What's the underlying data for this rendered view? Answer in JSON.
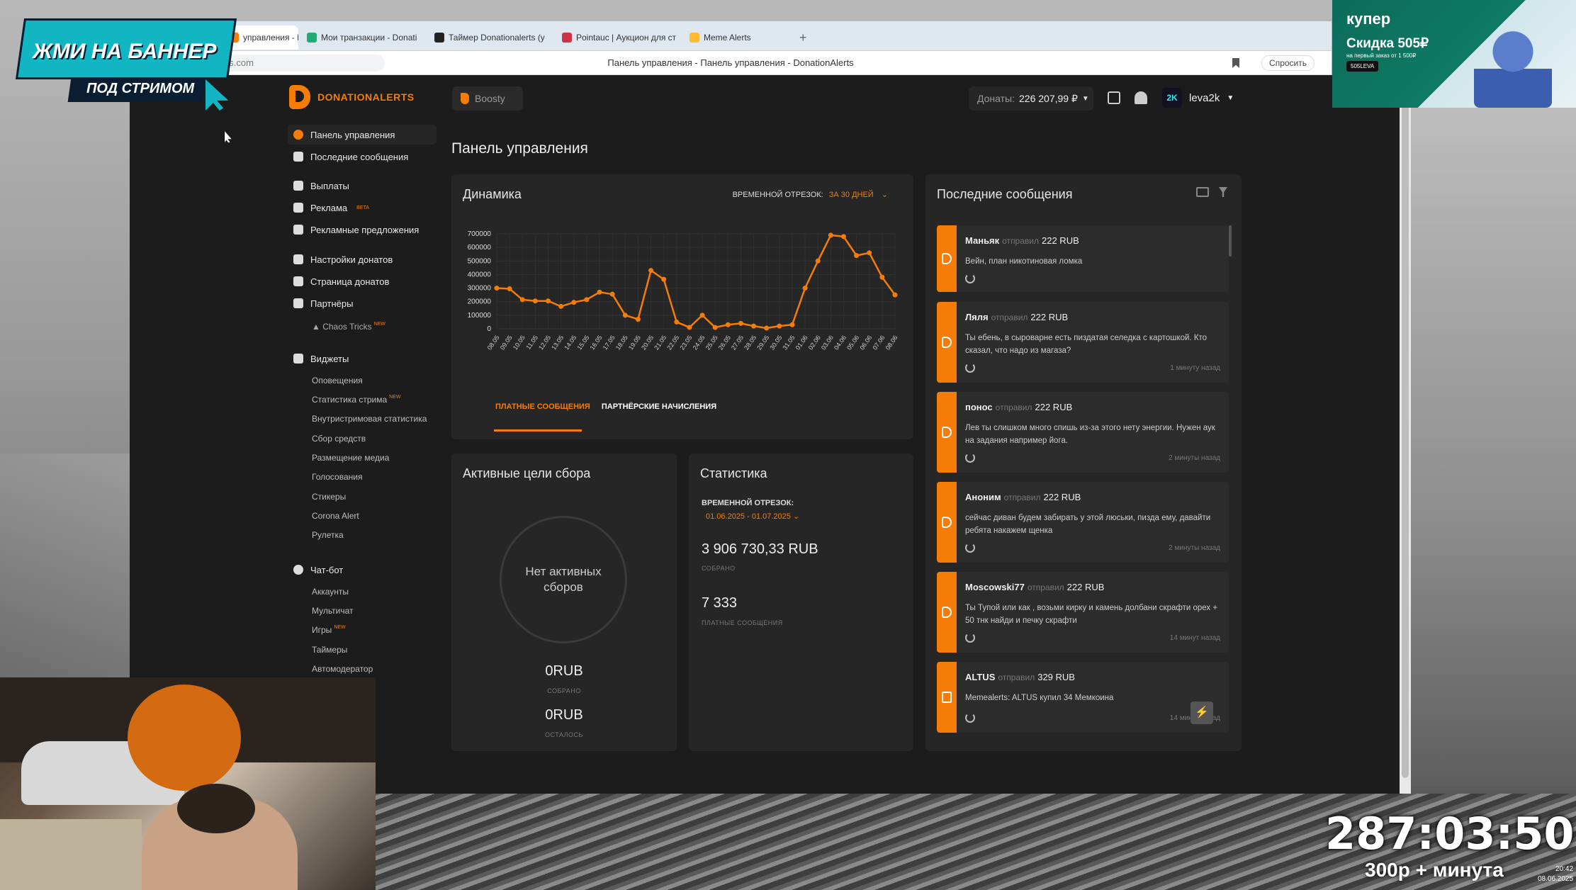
{
  "browser": {
    "tabs": [
      {
        "label": "управления - П"
      },
      {
        "label": "Мои транзакции - Donati"
      },
      {
        "label": "Таймер Donationalerts (у"
      },
      {
        "label": "Pointauc | Аукцион для ст"
      },
      {
        "label": "Meme Alerts"
      }
    ],
    "new_tab_symbol": "+",
    "url": "www.donationalerts.com",
    "page_title": "Панель управления - Панель управления - DonationAlerts",
    "ask_label": "Спросить"
  },
  "topbar": {
    "logo_text": "DONATIONALERTS",
    "boosty_label": "Boosty",
    "donats_label": "Донаты:",
    "donats_value": "226 207,99 ₽",
    "username": "leva2k",
    "avatar_text": "2K"
  },
  "sidebar": {
    "items": [
      {
        "label": "Панель управления"
      },
      {
        "label": "Последние сообщения"
      },
      {
        "label": "Выплаты"
      },
      {
        "label": "Реклама",
        "badge": "BETA"
      },
      {
        "label": "Рекламные предложения"
      },
      {
        "label": "Настройки донатов"
      },
      {
        "label": "Страница донатов"
      },
      {
        "label": "Партнёры"
      },
      {
        "label": "Виджеты"
      },
      {
        "label": "Чат-бот"
      }
    ],
    "partner_sub": {
      "label": "Chaos Tricks",
      "badge": "NEW"
    },
    "widgets_sub": [
      {
        "label": "Оповещения"
      },
      {
        "label": "Статистика стрима",
        "badge": "NEW"
      },
      {
        "label": "Внутристримовая статистика"
      },
      {
        "label": "Сбор средств"
      },
      {
        "label": "Размещение медиа"
      },
      {
        "label": "Голосования"
      },
      {
        "label": "Стикеры"
      },
      {
        "label": "Corona Alert"
      },
      {
        "label": "Рулетка"
      }
    ],
    "chatbot_sub": [
      {
        "label": "Аккаунты"
      },
      {
        "label": "Мультичат"
      },
      {
        "label": "Игры",
        "badge": "NEW"
      },
      {
        "label": "Таймеры"
      },
      {
        "label": "Автомодератор"
      }
    ]
  },
  "main": {
    "page_title": "Панель управления",
    "dynamics": {
      "title": "Динамика",
      "period_label": "ВРЕМЕННОЙ ОТРЕЗОК:",
      "period_value": "ЗА 30 ДНЕЙ",
      "tab_paid": "ПЛАТНЫЕ СООБЩЕНИЯ",
      "tab_partner": "ПАРТНЁРСКИЕ НАЧИСЛЕНИЯ"
    },
    "goals": {
      "title": "Активные цели сбора",
      "empty_line1": "Нет активных",
      "empty_line2": "сборов",
      "collected_value": "0RUB",
      "collected_label": "СОБРАНО",
      "left_value": "0RUB",
      "left_label": "ОСТАЛОСЬ"
    },
    "stats": {
      "title": "Статистика",
      "period_label": "ВРЕМЕННОЙ ОТРЕЗОК:",
      "period_value": "01.06.2025 - 01.07.2025",
      "total_value": "3 906 730,33 RUB",
      "total_label": "СОБРАНО",
      "count_value": "7 333",
      "count_label": "ПЛАТНЫЕ СООБЩЕНИЯ"
    }
  },
  "messages": {
    "title": "Последние сообщения",
    "sent_word": "отправил",
    "items": [
      {
        "name": "Маньяк",
        "amount": "222 RUB",
        "text": "Вейн, план никотиновая ломка",
        "ago": ""
      },
      {
        "name": "Ляля",
        "amount": "222 RUB",
        "text": "Ты ебень, в сыроварне есть пиздатая селедка с картошкой. Кто сказал, что надо из магаза?",
        "ago": "1 минуту назад"
      },
      {
        "name": "понос",
        "amount": "222 RUB",
        "text": "Лев ты слишком много спишь из-за этого нету энергии. Нужен аук на задания например йога.",
        "ago": "2 минуты назад"
      },
      {
        "name": "Аноним",
        "amount": "222 RUB",
        "text": "сейчас диван будем забирать у этой люськи, пизда ему, давайти ребята накажем щенка",
        "ago": "2 минуты назад"
      },
      {
        "name": "Moscowski77",
        "amount": "222 RUB",
        "text": "Ты Тупой или как , возьми кирку и камень долбани скрафти орех + 50 тнк найди и печку скрафти",
        "ago": "14 минут назад"
      },
      {
        "name": "ALTUS",
        "amount": "329 RUB",
        "text": "Memealerts: ALTUS купил 34 Мемкоина",
        "ago": "14 минут назад"
      }
    ]
  },
  "overlay": {
    "banner_line1": "ЖМИ НА БАННЕР",
    "banner_line2": "ПОД СТРИМОМ",
    "ad_brand": "купер",
    "ad_promo": "Скидка 505₽",
    "ad_sub": "на первый заказ от 1 500₽",
    "ad_code": "505LEVA",
    "timer": "287:03:50",
    "timer_sub": "300р + минута",
    "clock_time": "20:42",
    "clock_date": "08.06.2025"
  },
  "colors": {
    "accent": "#f57d07",
    "bg": "#1c1c1c",
    "card": "#262626"
  },
  "chart_data": {
    "type": "line",
    "title": "Динамика",
    "x": [
      "08.05",
      "09.05",
      "10.05",
      "11.05",
      "12.05",
      "13.05",
      "14.05",
      "15.05",
      "16.05",
      "17.05",
      "18.05",
      "19.05",
      "20.05",
      "21.05",
      "22.05",
      "23.05",
      "24.05",
      "25.05",
      "26.05",
      "27.05",
      "28.05",
      "29.05",
      "30.05",
      "31.05",
      "01.06",
      "02.06",
      "03.06",
      "04.06",
      "05.06",
      "06.06",
      "07.06",
      "08.06"
    ],
    "series": [
      {
        "values": [
          300000,
          295000,
          215000,
          205000,
          205000,
          165000,
          195000,
          215000,
          270000,
          255000,
          100000,
          70000,
          430000,
          365000,
          50000,
          10000,
          100000,
          10000,
          30000,
          40000,
          20000,
          5000,
          20000,
          30000,
          300000,
          500000,
          690000,
          680000,
          540000,
          560000,
          380000,
          250000
        ]
      }
    ],
    "yticks": [
      0,
      100000,
      200000,
      300000,
      400000,
      500000,
      600000,
      700000
    ],
    "ylim": [
      0,
      700000
    ],
    "grid": true
  }
}
